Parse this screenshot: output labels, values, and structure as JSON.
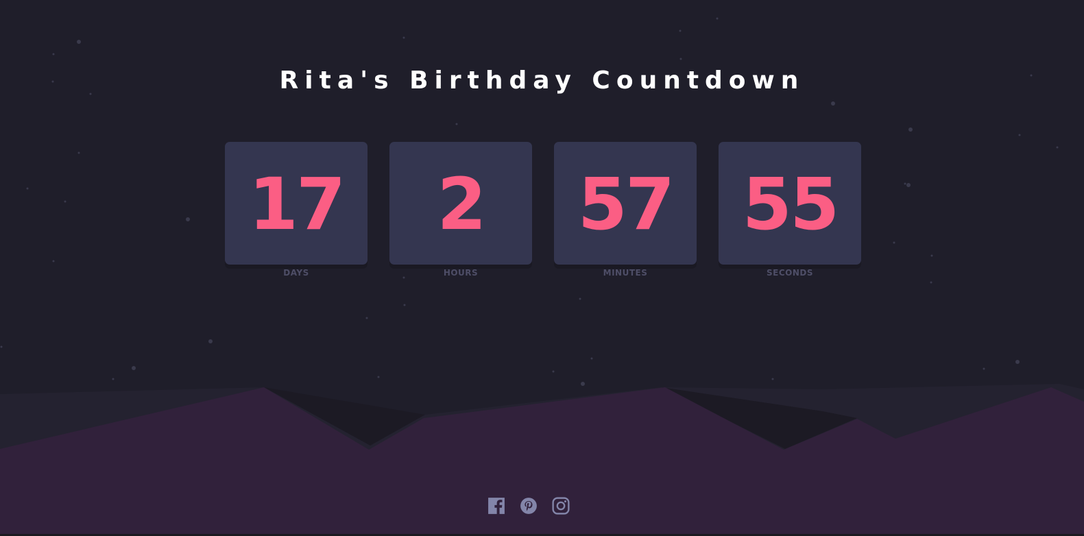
{
  "page": {
    "title": "Rita's Birthday Countdown"
  },
  "countdown": {
    "units": [
      {
        "value": "17",
        "label": "DAYS"
      },
      {
        "value": "2",
        "label": "HOURS"
      },
      {
        "value": "57",
        "label": "MINUTES"
      },
      {
        "value": "55",
        "label": "SECONDS"
      }
    ]
  },
  "social": {
    "links": [
      {
        "icon": "facebook-icon"
      },
      {
        "icon": "pinterest-icon"
      },
      {
        "icon": "instagram-icon"
      }
    ]
  },
  "colors": {
    "background": "#1f1e2a",
    "card": "#343650",
    "value": "#fb5e84",
    "label": "#4e4e67",
    "hills": "#31213b",
    "icon": "#8385a9"
  }
}
